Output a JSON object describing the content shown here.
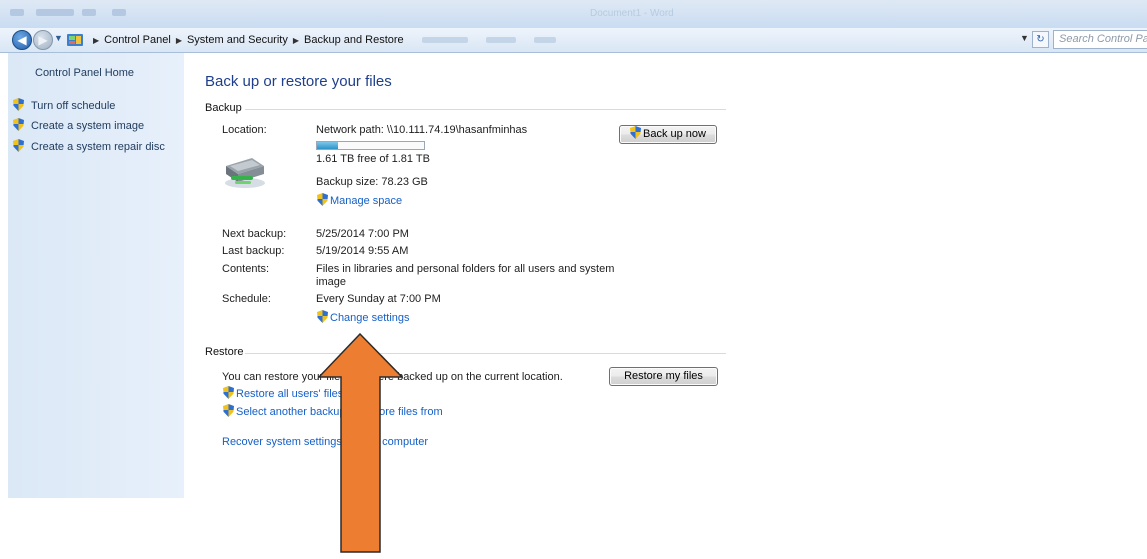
{
  "window": {
    "title": "Document1 - Word"
  },
  "address_bar": {
    "breadcrumbs": [
      "Control Panel",
      "System and Security",
      "Backup and Restore"
    ],
    "search_placeholder": "Search Control Pa"
  },
  "left_nav": {
    "home_label": "Control Panel Home",
    "tasks": [
      {
        "label": "Turn off schedule",
        "icon": "shield-icon"
      },
      {
        "label": "Create a system image",
        "icon": "shield-icon"
      },
      {
        "label": "Create a system repair disc",
        "icon": "shield-icon"
      }
    ]
  },
  "main": {
    "page_title": "Back up or restore your files",
    "backup": {
      "header": "Backup",
      "location_label": "Location:",
      "location_value": "Network path: \\\\10.111.74.19\\hasanfminhas",
      "space_used_fraction": 0.2,
      "free_space": "1.61 TB free of 1.81 TB",
      "backup_size": "Backup size: 78.23 GB",
      "manage_space_link": "Manage space",
      "back_up_now_button": "Back up now",
      "next_backup_label": "Next backup:",
      "next_backup_value": "5/25/2014 7:00 PM",
      "last_backup_label": "Last backup:",
      "last_backup_value": "5/19/2014 9:55 AM",
      "contents_label": "Contents:",
      "contents_value_line1": "Files in libraries and personal folders for all users and system",
      "contents_value_line2": "image",
      "schedule_label": "Schedule:",
      "schedule_value": "Every Sunday at 7:00 PM",
      "change_settings_link": "Change settings"
    },
    "restore": {
      "header": "Restore",
      "description": "You can restore your files that were backed up on the current location.",
      "restore_all_users_link": "Restore all users' files",
      "select_another_backup_link": "Select another backup to restore files from",
      "recover_system_link": "Recover system settings or your computer",
      "restore_my_files_button": "Restore my files"
    }
  },
  "annotation": {
    "arrow_color": "#ED7D31",
    "arrow_icon": "up-arrow-annotation"
  },
  "colors": {
    "link": "#1560C7",
    "title": "#1F3F8C",
    "nav_pane": "#DBE8F6"
  }
}
